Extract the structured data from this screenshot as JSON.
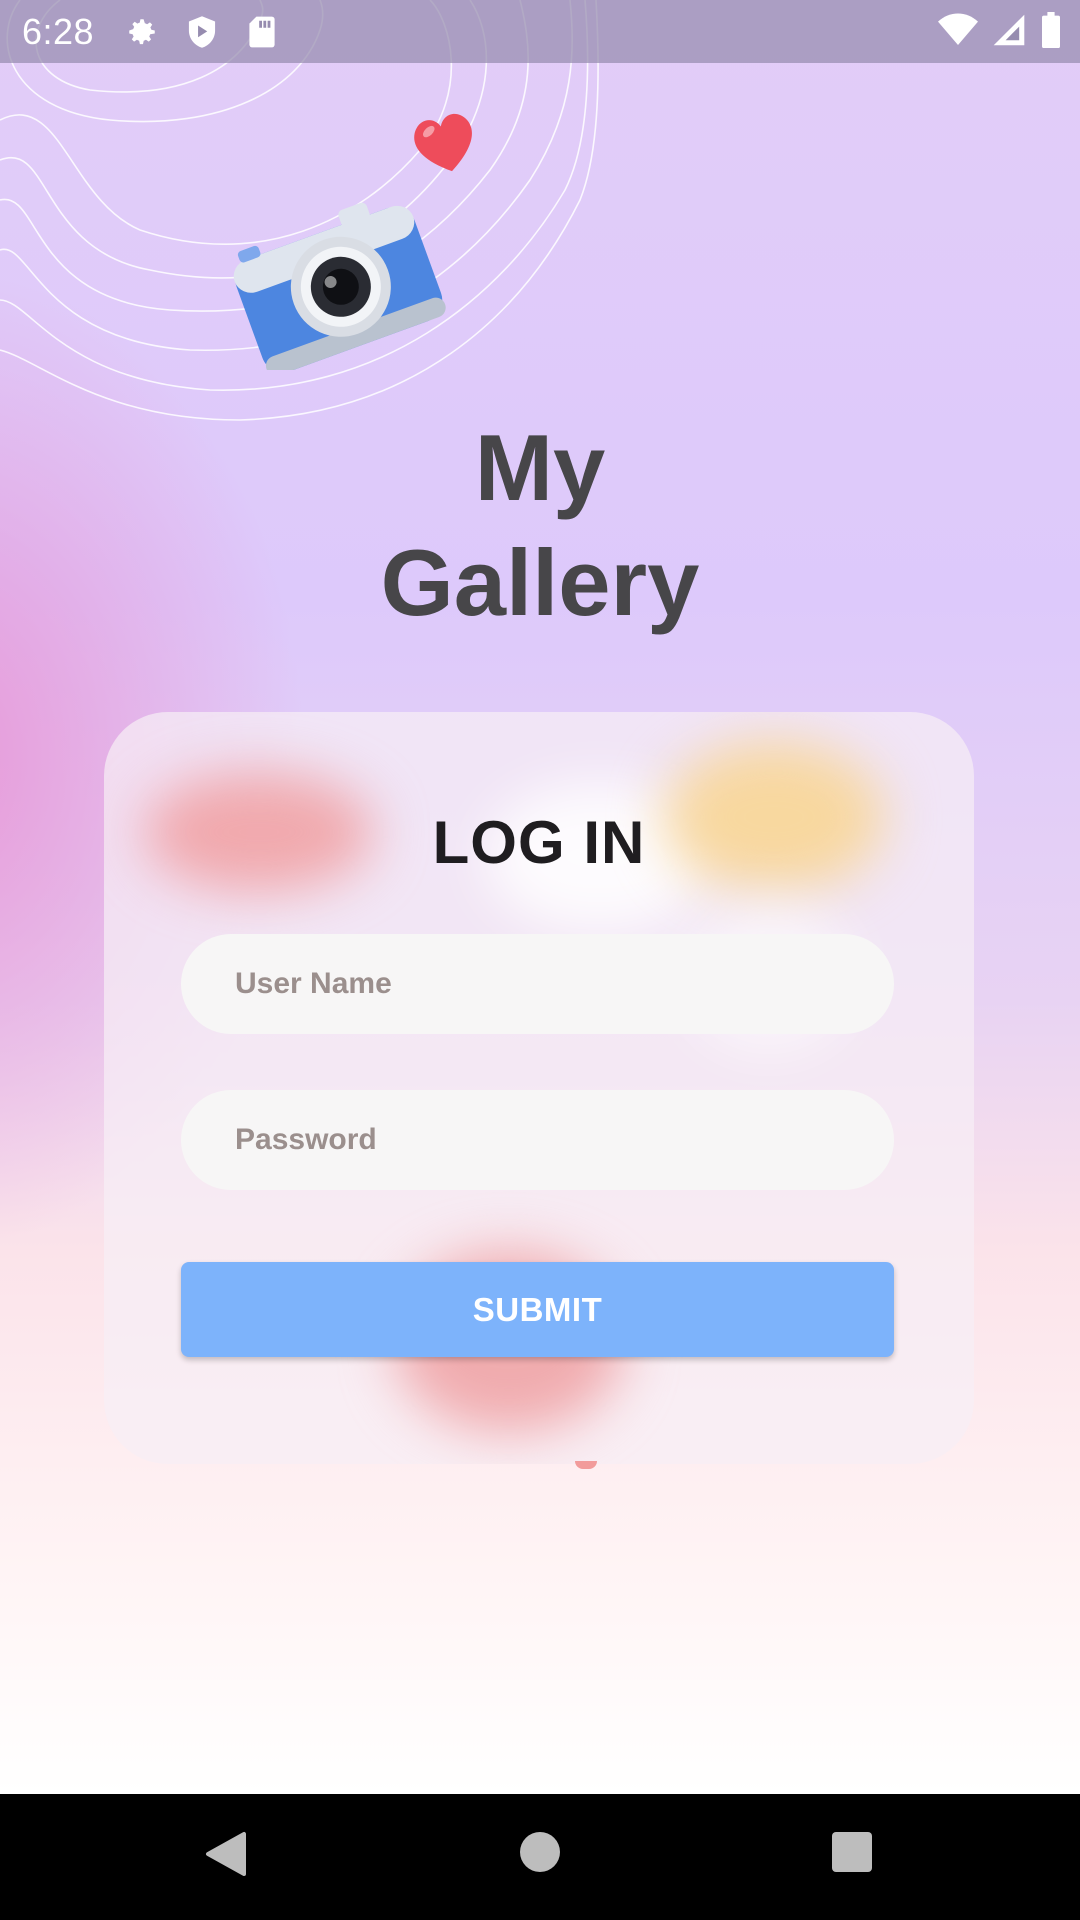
{
  "status_bar": {
    "time": "6:28",
    "icons_left": [
      "gear-icon",
      "shield-icon",
      "sd-card-icon"
    ],
    "icons_right": [
      "wifi-icon",
      "cell-signal-icon",
      "battery-icon"
    ]
  },
  "app": {
    "title_line1": "My",
    "title_line2": "Gallery"
  },
  "login": {
    "heading": "LOG IN",
    "username_placeholder": "User Name",
    "username_value": "",
    "password_placeholder": "Password",
    "password_value": "",
    "submit_label": "SUBMIT"
  },
  "colors": {
    "submit_button": "#7db3fb",
    "title_text": "#474649",
    "heading_text": "#1f1d20"
  },
  "nav_bar": {
    "buttons": [
      "back-icon",
      "home-icon",
      "recents-icon"
    ]
  }
}
